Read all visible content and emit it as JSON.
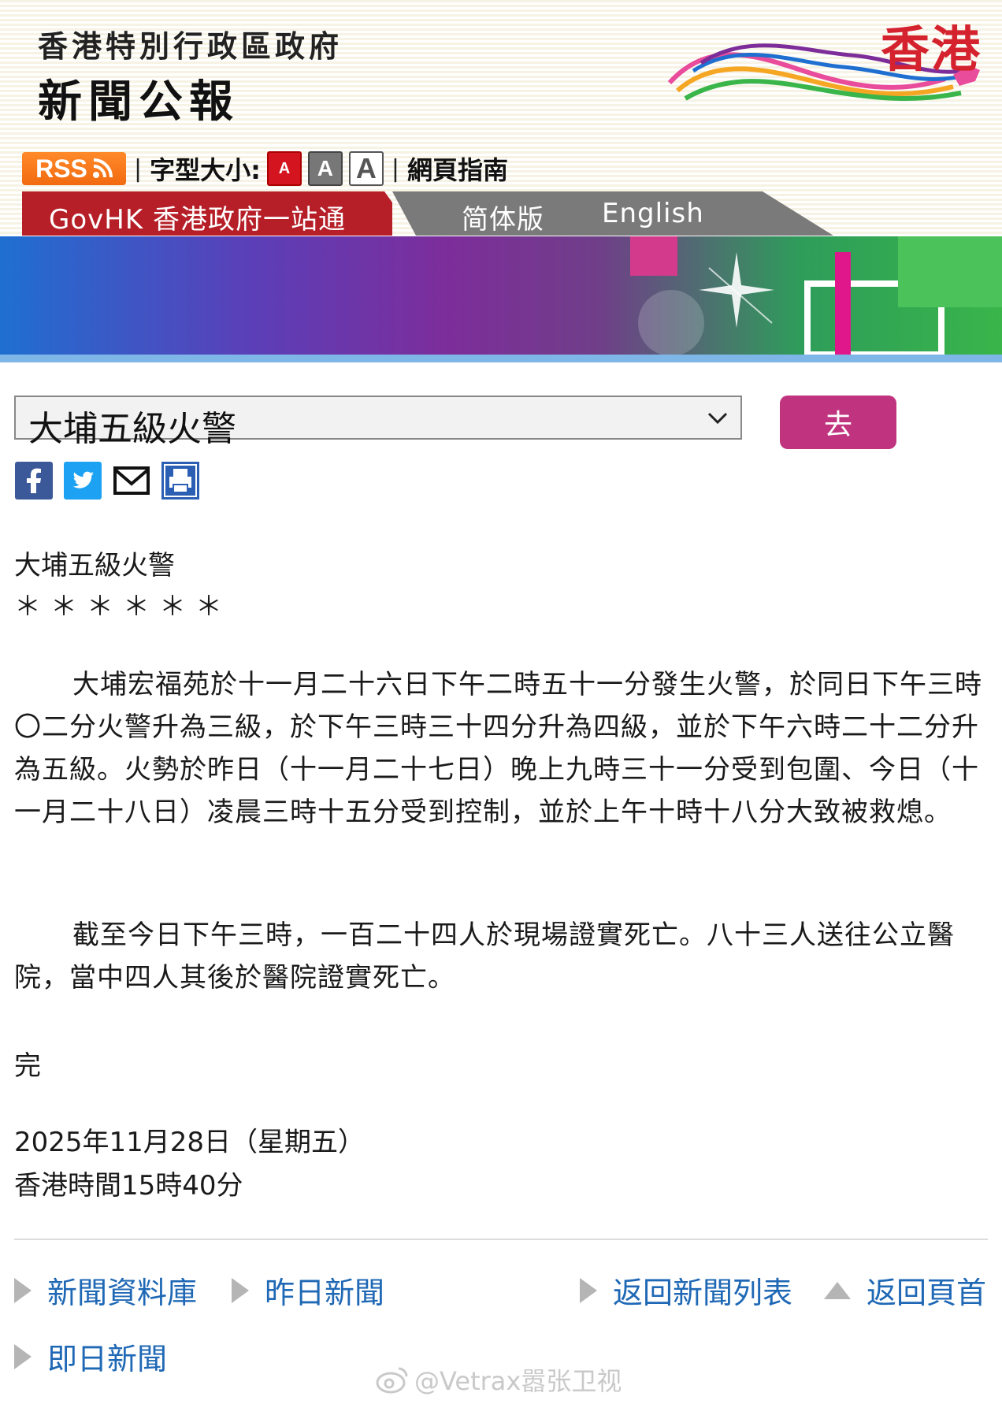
{
  "header": {
    "gov_title": "香港特別行政區政府",
    "site_title": "新聞公報",
    "brand": "香港"
  },
  "toolbar": {
    "rss_label": "RSS",
    "font_size_label": "字型大小:",
    "font_small": "A",
    "font_medium": "A",
    "font_large": "A",
    "guide_label": "網頁指南",
    "separator": "|"
  },
  "nav": {
    "govhk": "GovHK 香港政府一站通",
    "simplified": "简体版",
    "english": "English"
  },
  "selector": {
    "selected": "大埔五級火警",
    "go_label": "去"
  },
  "share": [
    "facebook-icon",
    "twitter-icon",
    "email-icon",
    "print-icon"
  ],
  "article": {
    "title": "大埔五級火警",
    "stars": "＊＊＊＊＊＊",
    "paragraph1": "大埔宏福苑於十一月二十六日下午二時五十一分發生火警，於同日下午三時〇二分火警升為三級，於下午三時三十四分升為四級，並於下午六時二十二分升為五級。火勢於昨日（十一月二十七日）晚上九時三十一分受到包圍、今日（十一月二十八日）凌晨三時十五分受到控制，並於上午十時十八分大致被救熄。",
    "paragraph2": "截至今日下午三時，一百二十四人於現場證實死亡。八十三人送往公立醫院，當中四人其後於醫院證實死亡。",
    "end": "完",
    "date": "2025年11月28日（星期五）",
    "time": "香港時間15時40分"
  },
  "footer": {
    "archive": "新聞資料庫",
    "yesterday": "昨日新聞",
    "back_list": "返回新聞列表",
    "top": "返回頁首",
    "today": "即日新聞"
  },
  "watermark": "@Vetrax嚣张卫视",
  "colors": {
    "nav_red": "#b61f28",
    "go_button": "#c0337f",
    "link_blue": "#1f68b5",
    "rss_orange": "#f26a10"
  }
}
